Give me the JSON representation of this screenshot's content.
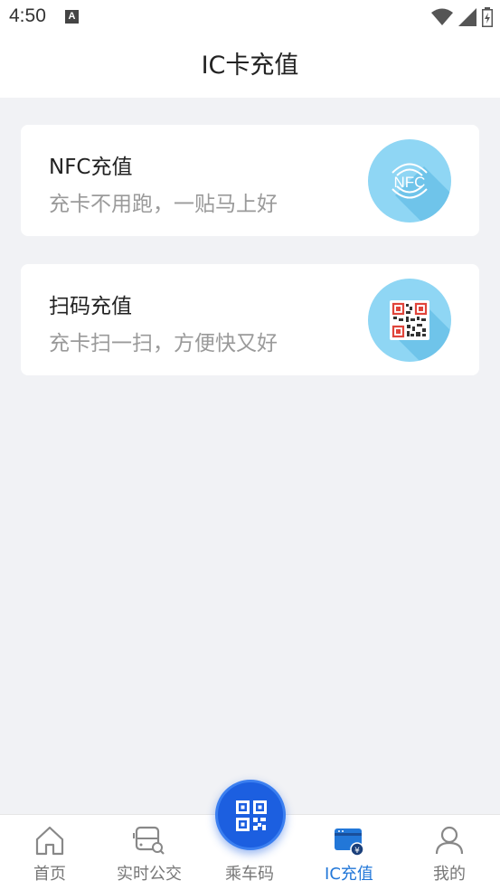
{
  "status_bar": {
    "time": "4:50",
    "notification_letter": "A"
  },
  "header": {
    "title": "IC卡充值"
  },
  "cards": [
    {
      "title": "NFC充值",
      "subtitle": "充卡不用跑，一贴马上好",
      "badge_text": "NFC",
      "icon": "nfc-icon"
    },
    {
      "title": "扫码充值",
      "subtitle": "充卡扫一扫，方便快又好",
      "icon": "qr-code-icon"
    }
  ],
  "nav": {
    "items": [
      {
        "label": "首页",
        "icon": "home-icon"
      },
      {
        "label": "实时公交",
        "icon": "bus-search-icon"
      },
      {
        "label": "乘车码",
        "icon": "qr-code-icon"
      },
      {
        "label": "IC充值",
        "icon": "card-recharge-icon",
        "active": true
      },
      {
        "label": "我的",
        "icon": "user-icon"
      }
    ]
  },
  "colors": {
    "accent": "#2277d8",
    "fab": "#1c5fe0",
    "badge": "#8fd6f4"
  }
}
